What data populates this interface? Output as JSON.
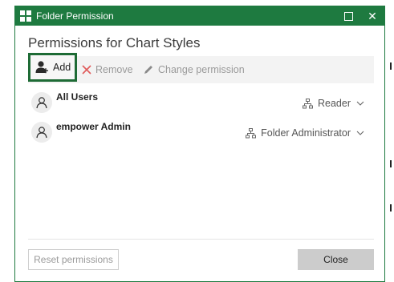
{
  "window": {
    "title": "Folder Permission",
    "accent_color": "#1e7a40",
    "controls": {
      "maximize_icon": "maximize-icon",
      "close_glyph": "✕"
    }
  },
  "heading": "Permissions for Chart Styles",
  "toolbar": {
    "add_label": "Add",
    "remove_label": "Remove",
    "change_label": "Change permission"
  },
  "users": [
    {
      "name": "All Users",
      "role": "Reader",
      "icon": "person-icon"
    },
    {
      "name": "empower Admin",
      "role": "Folder Administrator",
      "icon": "person-icon"
    }
  ],
  "footer": {
    "reset_label": "Reset permissions",
    "close_label": "Close"
  }
}
